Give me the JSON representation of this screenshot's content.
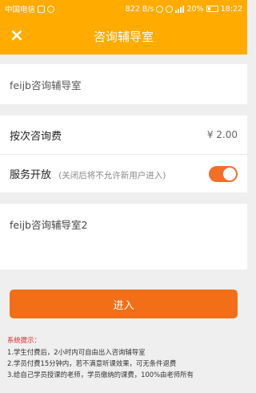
{
  "status_bar": {
    "carrier": "中国电信",
    "network_speed": "822 B/s",
    "battery": "20%",
    "time": "18:22"
  },
  "header": {
    "close_icon": "×",
    "title": "咨询辅导室"
  },
  "form": {
    "room_name_value": "feijb咨询辅导室",
    "fee_label": "按次咨询费",
    "fee_value": "¥ 2.00",
    "service_label": "服务开放",
    "service_hint": "(关闭后将不允许新用户进入)",
    "service_enabled": true,
    "intro_text": "feijb咨询辅导室2"
  },
  "actions": {
    "enter_label": "进入"
  },
  "tips": {
    "title": "系统提示：",
    "items": [
      "1.学生付费后，2小时内可自由出入咨询辅导室",
      "2.学员付费15分钟内，若不满意听课效果，可无条件退费",
      "3.给自己学员授课的老师，学员缴纳的课费，100%由老师所有"
    ]
  },
  "colors": {
    "header_bg": "#ffab00",
    "accent": "#f26f18",
    "tips_title": "#d62424"
  }
}
